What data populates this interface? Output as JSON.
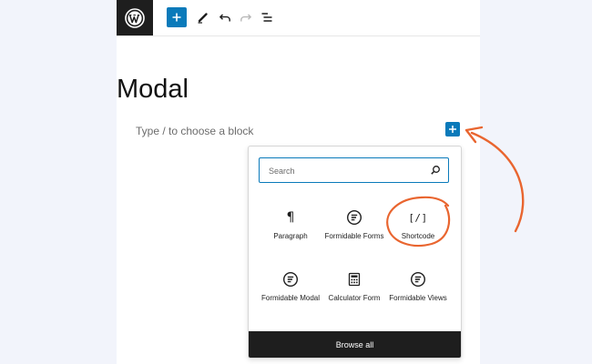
{
  "toolbar": {
    "logo_icon": "wordpress-logo-icon",
    "buttons": [
      "add-block-icon",
      "pencil-icon",
      "undo-icon",
      "redo-icon",
      "list-view-icon"
    ]
  },
  "page": {
    "title": "Modal",
    "block_placeholder": "Type / to choose a block"
  },
  "inserter": {
    "search_placeholder": "Search",
    "blocks": [
      {
        "label": "Paragraph",
        "icon": "paragraph-icon"
      },
      {
        "label": "Formidable Forms",
        "icon": "formidable-icon"
      },
      {
        "label": "Shortcode",
        "icon": "shortcode-icon",
        "glyph": "[/]"
      },
      {
        "label": "Formidable Modal",
        "icon": "formidable-icon"
      },
      {
        "label": "Calculator Form",
        "icon": "calculator-icon"
      },
      {
        "label": "Formidable Views",
        "icon": "formidable-icon"
      }
    ],
    "browse_all_label": "Browse all"
  },
  "colors": {
    "accent": "#0a7aba",
    "annotation": "#e9652f",
    "dark": "#1e1e1e",
    "background": "#f2f4fb"
  }
}
